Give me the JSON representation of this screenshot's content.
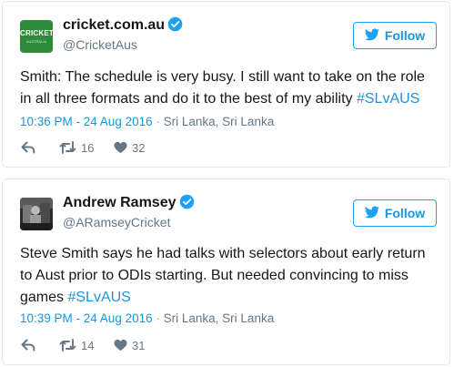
{
  "tweets": [
    {
      "avatar": {
        "text": "CRICKET",
        "sub": "AUSTRALIA",
        "icon": "cricket-australia-logo",
        "color": "#2e8b3a"
      },
      "name": "cricket.com.au",
      "handle": "@CricketAus",
      "follow_label": "Follow",
      "text": "Smith: The schedule is very busy. I still want to take on the role in all three formats and do it to the best of my ability ",
      "hashtag": "#SLvAUS",
      "time": "10:36 PM - 24 Aug 2016",
      "separator": "·",
      "location": "Sri Lanka, Sri Lanka",
      "retweets": "16",
      "likes": "32"
    },
    {
      "avatar": {
        "icon": "profile-photo"
      },
      "name": "Andrew Ramsey",
      "handle": "@ARamseyCricket",
      "follow_label": "Follow",
      "text": "Steve Smith says he had talks with selectors about early return to Aust prior to ODIs starting. But needed convincing to miss games ",
      "hashtag": "#SLvAUS",
      "time": "10:39 PM - 24 Aug 2016",
      "separator": "·",
      "location": "Sri Lanka, Sri Lanka",
      "retweets": "14",
      "likes": "31"
    }
  ],
  "colors": {
    "accent": "#1da1f2",
    "link": "#1b95e0",
    "muted": "#657786",
    "text": "#14171a",
    "border": "#e1e8ed"
  },
  "icons": [
    "verified-icon",
    "twitter-bird-icon",
    "reply-icon",
    "retweet-icon",
    "heart-icon"
  ]
}
